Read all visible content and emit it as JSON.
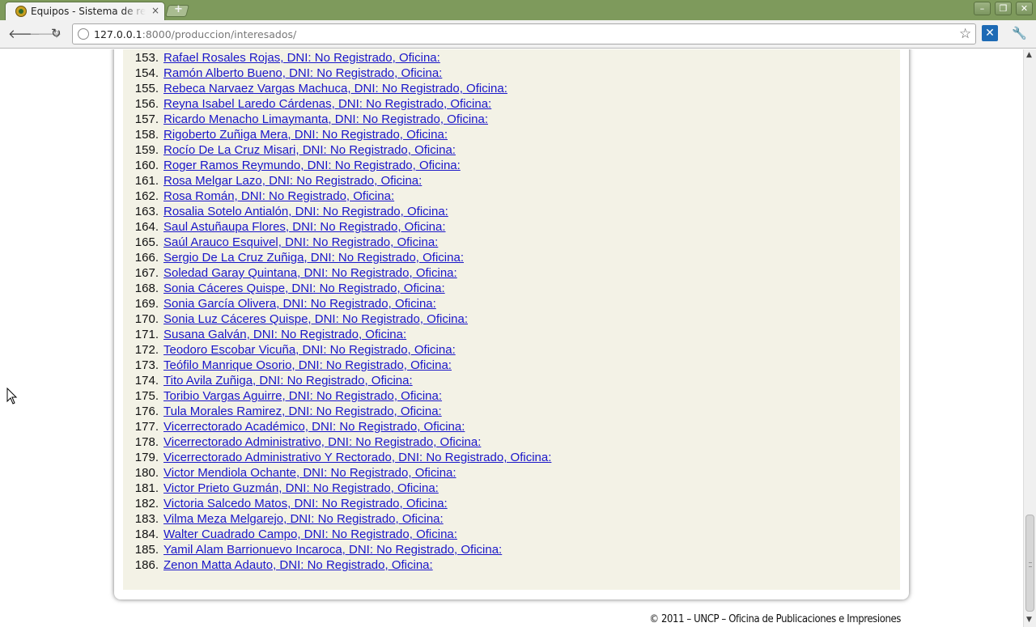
{
  "browser": {
    "tab_title": "Equipos - Sistema de re",
    "tab_close": "×",
    "new_tab": "+",
    "url_host": "127.0.0.1",
    "url_rest": ":8000/produccion/interesados/",
    "back": "🡐",
    "forward": "🡒",
    "reload": "↻",
    "star": "☆",
    "extension": "✕",
    "wrench": "🔧",
    "minimize": "–",
    "restore": "❐",
    "close": "✕"
  },
  "list": {
    "items": [
      {
        "num": "153.",
        "text": "Rafael Rosales Rojas, DNI: No Registrado, Oficina:"
      },
      {
        "num": "154.",
        "text": "Ramón Alberto Bueno, DNI: No Registrado, Oficina:"
      },
      {
        "num": "155.",
        "text": "Rebeca Narvaez Vargas Machuca, DNI: No Registrado, Oficina:"
      },
      {
        "num": "156.",
        "text": "Reyna Isabel Laredo Cárdenas, DNI: No Registrado, Oficina:"
      },
      {
        "num": "157.",
        "text": "Ricardo Menacho Limaymanta, DNI: No Registrado, Oficina:"
      },
      {
        "num": "158.",
        "text": "Rigoberto Zuñiga Mera, DNI: No Registrado, Oficina:"
      },
      {
        "num": "159.",
        "text": "Rocío De La Cruz Misari, DNI: No Registrado, Oficina:"
      },
      {
        "num": "160.",
        "text": "Roger Ramos Reymundo, DNI: No Registrado, Oficina:"
      },
      {
        "num": "161.",
        "text": "Rosa Melgar Lazo, DNI: No Registrado, Oficina:"
      },
      {
        "num": "162.",
        "text": "Rosa Román, DNI: No Registrado, Oficina:"
      },
      {
        "num": "163.",
        "text": "Rosalia Sotelo Antialón, DNI: No Registrado, Oficina:"
      },
      {
        "num": "164.",
        "text": "Saul Astuñaupa Flores, DNI: No Registrado, Oficina:"
      },
      {
        "num": "165.",
        "text": "Saúl Arauco Esquivel, DNI: No Registrado, Oficina:"
      },
      {
        "num": "166.",
        "text": "Sergio De La Cruz Zuñiga, DNI: No Registrado, Oficina:"
      },
      {
        "num": "167.",
        "text": "Soledad Garay Quintana, DNI: No Registrado, Oficina:"
      },
      {
        "num": "168.",
        "text": "Sonia Cáceres Quispe, DNI: No Registrado, Oficina:"
      },
      {
        "num": "169.",
        "text": "Sonia García Olivera, DNI: No Registrado, Oficina:"
      },
      {
        "num": "170.",
        "text": "Sonia Luz Cáceres Quispe, DNI: No Registrado, Oficina:"
      },
      {
        "num": "171.",
        "text": "Susana Galván, DNI: No Registrado, Oficina:"
      },
      {
        "num": "172.",
        "text": "Teodoro Escobar Vicuña, DNI: No Registrado, Oficina:"
      },
      {
        "num": "173.",
        "text": "Teófilo Manrique Osorio, DNI: No Registrado, Oficina:"
      },
      {
        "num": "174.",
        "text": "Tito Avila Zuñiga, DNI: No Registrado, Oficina:"
      },
      {
        "num": "175.",
        "text": "Toribio Vargas Aguirre, DNI: No Registrado, Oficina:"
      },
      {
        "num": "176.",
        "text": "Tula Morales Ramirez, DNI: No Registrado, Oficina:"
      },
      {
        "num": "177.",
        "text": "Vicerrectorado Académico, DNI: No Registrado, Oficina:"
      },
      {
        "num": "178.",
        "text": "Vicerrectorado Administrativo, DNI: No Registrado, Oficina:"
      },
      {
        "num": "179.",
        "text": "Vicerrectorado Administrativo Y Rectorado, DNI: No Registrado, Oficina:"
      },
      {
        "num": "180.",
        "text": "Victor Mendiola Ochante, DNI: No Registrado, Oficina:"
      },
      {
        "num": "181.",
        "text": "Victor Prieto Guzmán, DNI: No Registrado, Oficina:"
      },
      {
        "num": "182.",
        "text": "Victoria Salcedo Matos, DNI: No Registrado, Oficina:"
      },
      {
        "num": "183.",
        "text": "Vilma Meza Melgarejo, DNI: No Registrado, Oficina:"
      },
      {
        "num": "184.",
        "text": "Walter Cuadrado Campo, DNI: No Registrado, Oficina:"
      },
      {
        "num": "185.",
        "text": "Yamil Alam Barrionuevo Incaroca, DNI: No Registrado, Oficina:"
      },
      {
        "num": "186.",
        "text": "Zenon Matta Adauto, DNI: No Registrado, Oficina:"
      }
    ]
  },
  "footer": {
    "text": "© 2011 – UNCP – Oficina de Publicaciones e Impresiones"
  },
  "colors": {
    "link": "#1a16c9",
    "content_bg": "#f3f2e6",
    "titlebar": "#7e9a5c"
  },
  "icons": {
    "favicon": "uncp-logo-icon",
    "globe": "page-info-icon",
    "star": "bookmark-star-icon",
    "extension": "extension-icon",
    "wrench": "wrench-menu-icon",
    "cursor": "mouse-pointer-icon"
  }
}
